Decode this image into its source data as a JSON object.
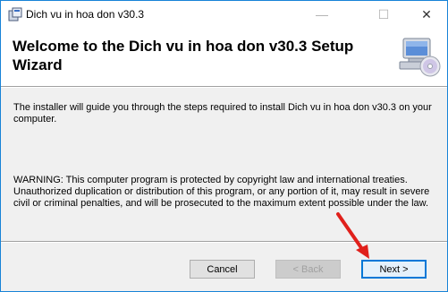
{
  "window": {
    "title": "Dich vu in hoa don v30.3",
    "controls": {
      "minimize": "—",
      "maximize": "☐",
      "close": "✕"
    }
  },
  "header": {
    "title": "Welcome to the Dich vu in hoa don v30.3 Setup Wizard",
    "icon": "computer-cd-icon"
  },
  "content": {
    "intro": "The installer will guide you through the steps required to install Dich vu in hoa don v30.3 on your computer.",
    "warning": "WARNING: This computer program is protected by copyright law and international treaties. Unauthorized duplication or distribution of this program, or any portion of it, may result in severe civil or criminal penalties, and will be prosecuted to the maximum extent possible under the law."
  },
  "buttons": {
    "cancel": "Cancel",
    "back": "< Back",
    "next": "Next >"
  },
  "colors": {
    "accent": "#0078d7",
    "annotation_arrow": "#e0201b"
  }
}
